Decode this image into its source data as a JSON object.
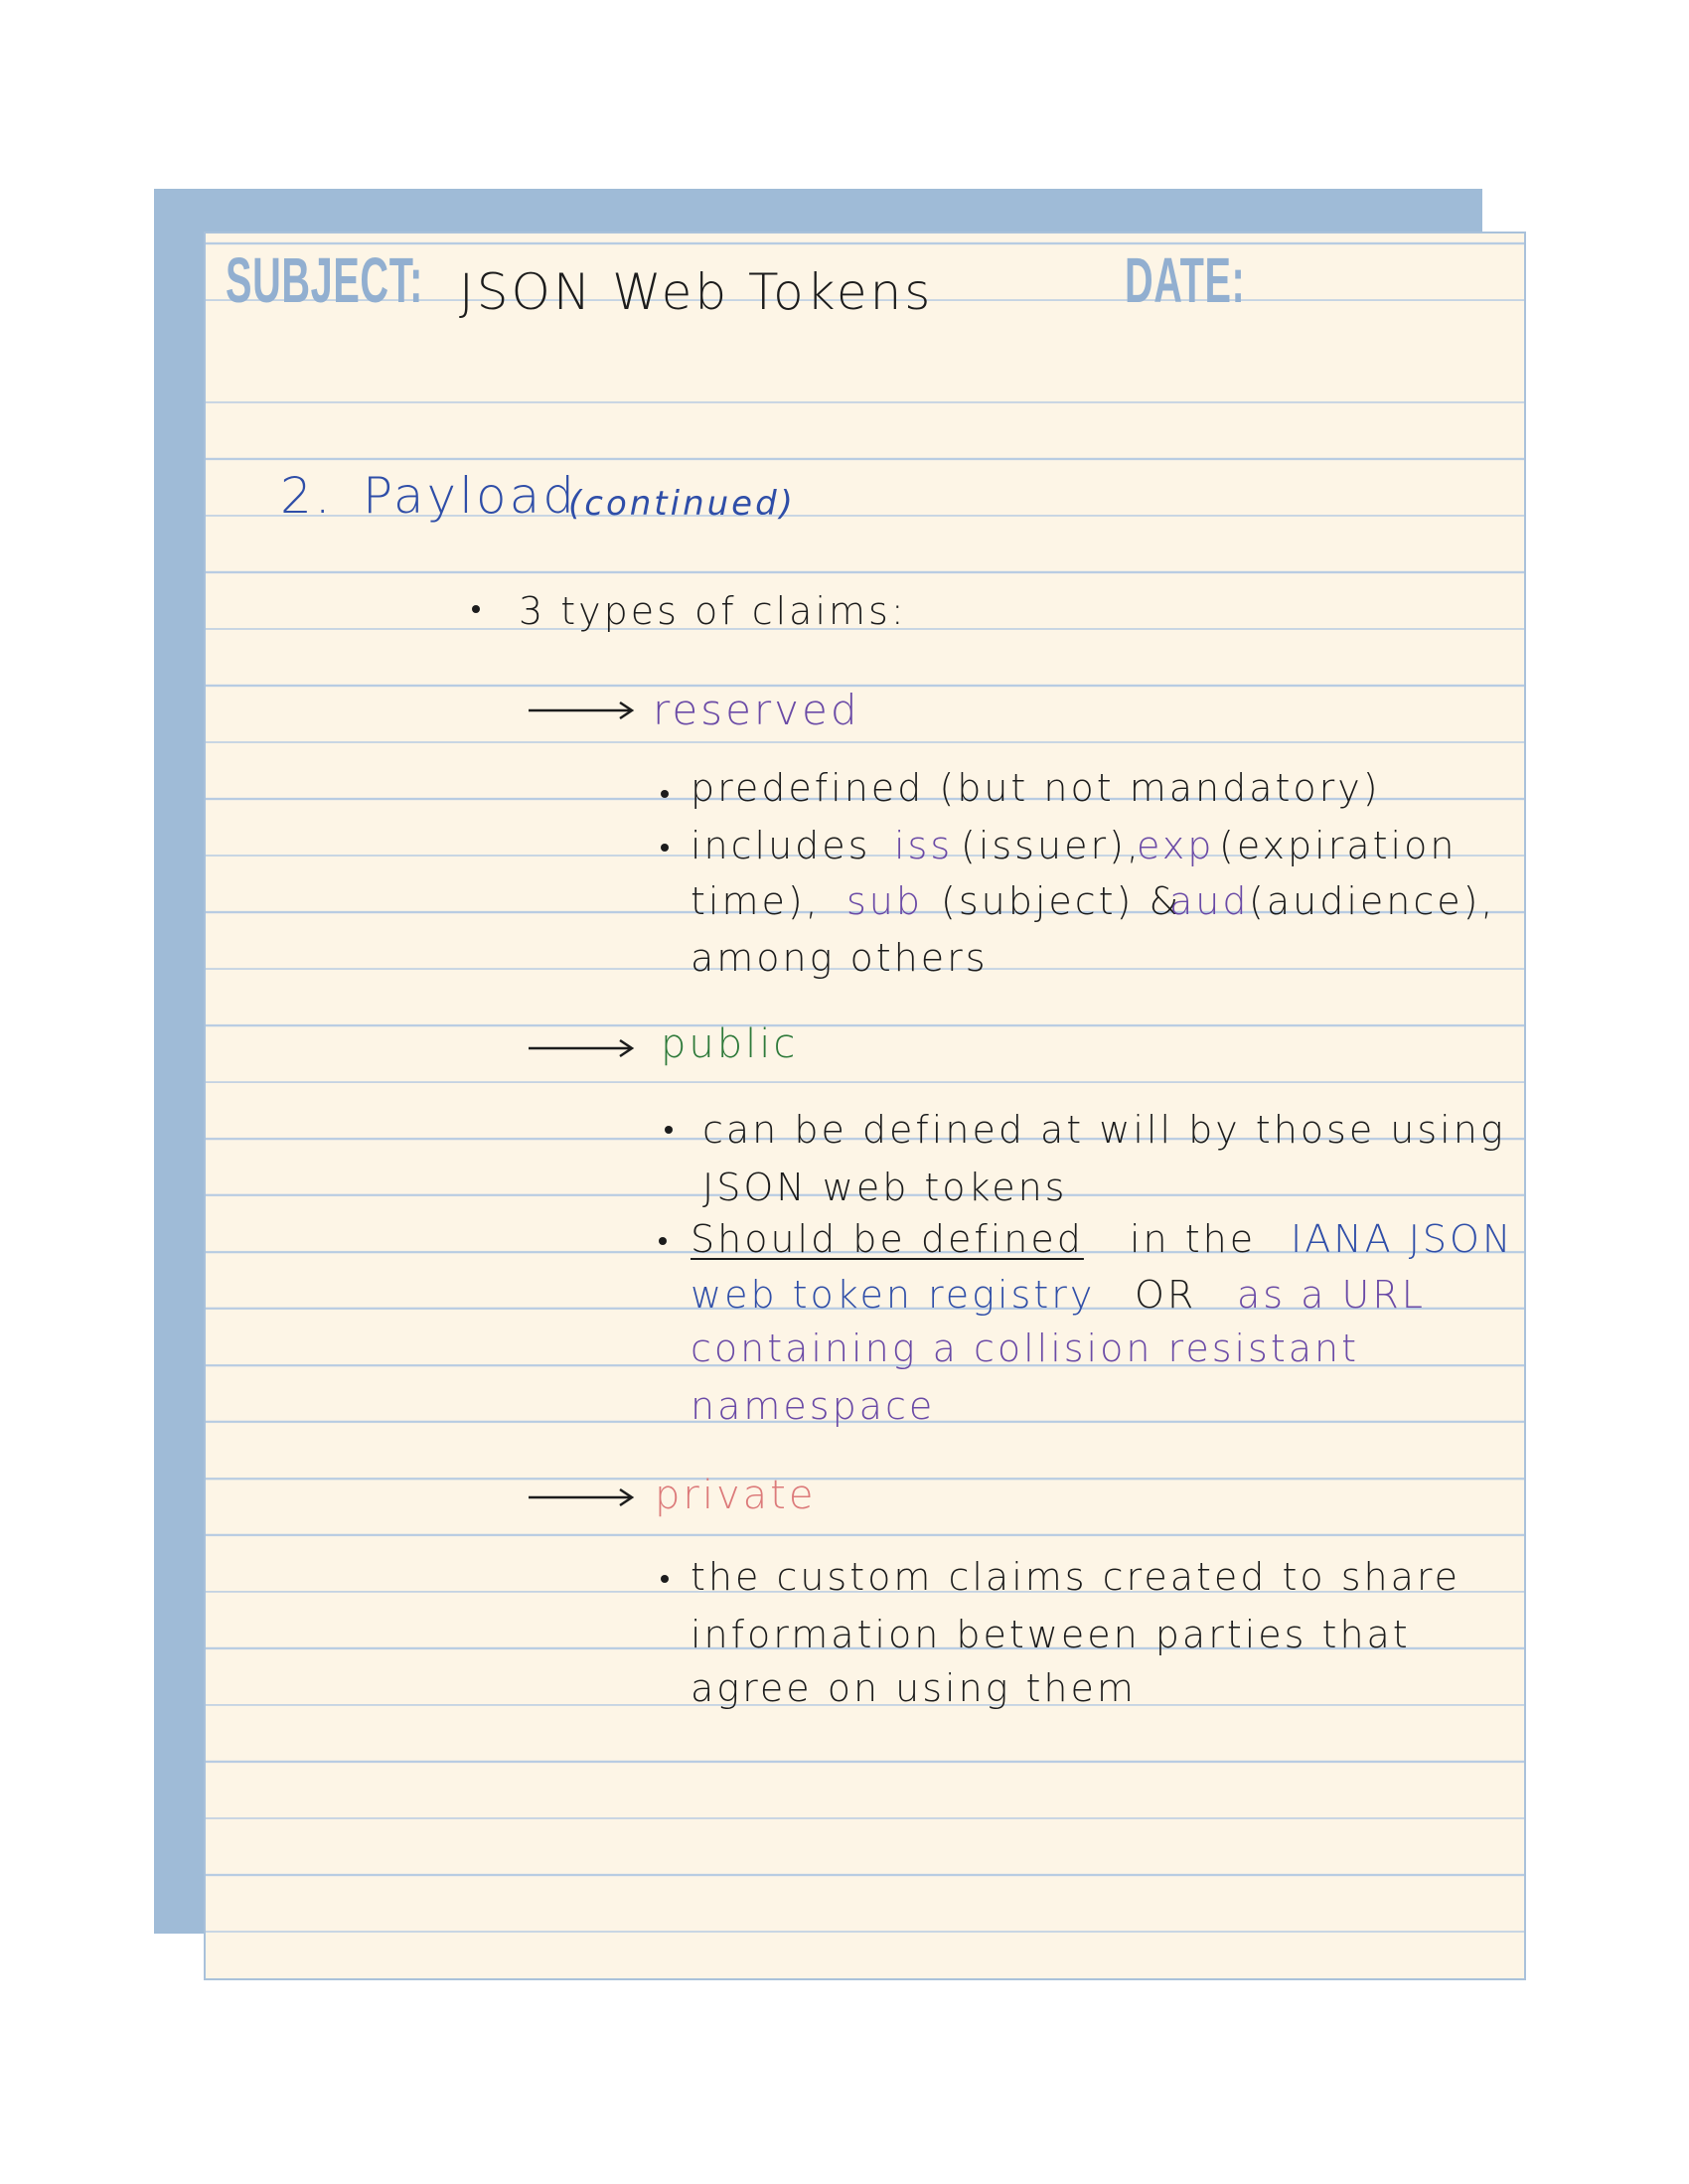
{
  "header": {
    "subject_label": "SUBJECT:",
    "subject_value": "JSON Web Tokens",
    "date_label": "DATE:",
    "date_value": ""
  },
  "section": {
    "number": "2.",
    "title": "Payload",
    "note": "(continued)"
  },
  "intro": "3 types of claims:",
  "claims": {
    "reserved": {
      "heading": "reserved",
      "b1": "predefined (but not mandatory)",
      "b2_l1_a": "includes",
      "b2_l1_b": "iss",
      "b2_l1_c": "(issuer),",
      "b2_l1_d": "exp",
      "b2_l1_e": "(expiration",
      "b2_l2_a": "time),",
      "b2_l2_b": "sub",
      "b2_l2_c": "(subject) &",
      "b2_l2_d": "aud",
      "b2_l2_e": "(audience),",
      "b2_l3": "among others"
    },
    "public": {
      "heading": "public",
      "b1_l1": "can be defined at will by those using",
      "b1_l2": "JSON web tokens",
      "b2_l1_a": "Should be defined",
      "b2_l1_b": "in the",
      "b2_l1_c": "IANA JSON",
      "b2_l2_a": "web token registry",
      "b2_l2_b": "OR",
      "b2_l2_c": "as a URL",
      "b2_l3": "containing a collision resistant",
      "b2_l4": "namespace"
    },
    "private": {
      "heading": "private",
      "b1_l1": "the custom claims created to share",
      "b1_l2": "information between parties that",
      "b1_l3": "agree on using them"
    }
  },
  "colors": {
    "paper": "#fdf5e6",
    "back_sheet": "#9fbbd7",
    "rule_lines": "#b7cbe2",
    "labels": "#92afd0",
    "ink_black": "#1c1c1c",
    "ink_blue": "#2f4ea8",
    "ink_purple": "#6a4aa6",
    "ink_green": "#2e7a3a",
    "ink_pink": "#dc7a7a"
  }
}
